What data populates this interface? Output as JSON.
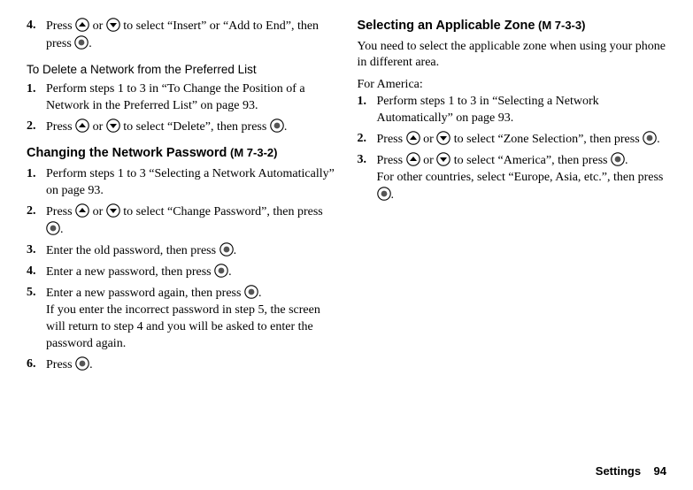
{
  "left": {
    "step4": {
      "num": "4.",
      "text1": "Press ",
      "text2": " or ",
      "text3": " to select “Insert” or “Add to End”, then press ",
      "text4": "."
    },
    "deleteHead": "To Delete a Network from the Preferred List",
    "del1": {
      "num": "1.",
      "text": "Perform steps 1 to 3 in “To Change the Position of a Network in the Preferred List” on page 93."
    },
    "del2": {
      "num": "2.",
      "text1": "Press ",
      "text2": " or ",
      "text3": " to select “Delete”, then press ",
      "text4": "."
    },
    "changeHead": "Changing the Network Password",
    "changeCode": " (M 7-3-2)",
    "chg1": {
      "num": "1.",
      "text": "Perform steps 1 to 3 “Selecting a Network Automatically” on page 93."
    },
    "chg2": {
      "num": "2.",
      "text1": "Press ",
      "text2": " or ",
      "text3": " to select “Change Password”, then press ",
      "text4": "."
    },
    "chg3": {
      "num": "3.",
      "text1": "Enter the old password, then press ",
      "text2": "."
    },
    "chg4": {
      "num": "4.",
      "text1": "Enter a new password, then press ",
      "text2": "."
    },
    "chg5": {
      "num": "5.",
      "text1": "Enter a new password again, then press ",
      "text2": ".",
      "note": "If you enter the incorrect password in step 5, the screen will return to step 4 and you will be asked to enter the password again."
    },
    "chg6": {
      "num": "6.",
      "text1": "Press ",
      "text2": "."
    }
  },
  "right": {
    "zoneHead": "Selecting an Applicable Zone",
    "zoneCode": " (M 7-3-3)",
    "intro": "You need to select the applicable zone when using your phone in different area.",
    "forAmerica": "For America:",
    "z1": {
      "num": "1.",
      "text": "Perform steps 1 to 3 in “Selecting a Network Automatically” on page 93."
    },
    "z2": {
      "num": "2.",
      "text1": "Press ",
      "text2": " or ",
      "text3": " to select “Zone Selection”, then press ",
      "text4": "."
    },
    "z3": {
      "num": "3.",
      "text1": "Press ",
      "text2": " or ",
      "text3": " to select “America”, then press ",
      "text4": ".",
      "note1": "For other countries, select “Europe, Asia, etc.”, then press ",
      "note2": "."
    }
  },
  "footer": {
    "label": "Settings",
    "page": "94"
  }
}
